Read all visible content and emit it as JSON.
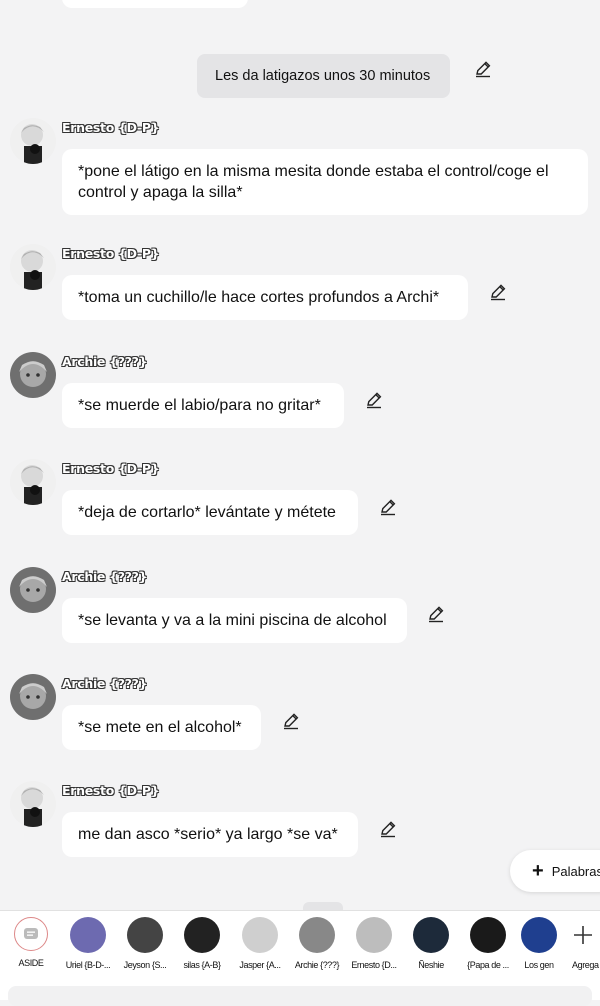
{
  "narration": "Les da latigazos unos 30 minutos",
  "messages": [
    {
      "name": "Ernesto {D-P}",
      "text": "*pone el látigo en la misma mesita donde estaba el control/coge el control y apaga la silla*"
    },
    {
      "name": "Ernesto {D-P}",
      "text": "*toma un cuchillo/le hace cortes profundos a Archi*"
    },
    {
      "name": "Archie {???}",
      "text": "*se muerde el labio/para no gritar*"
    },
    {
      "name": "Ernesto {D-P}",
      "text": "*deja de cortarlo* levántate y métete"
    },
    {
      "name": "Archie {???}",
      "text": "*se levanta y va a la mini piscina de alcohol"
    },
    {
      "name": "Archie {???}",
      "text": "*se mete en el alcohol*"
    },
    {
      "name": "Ernesto {D-P}",
      "text": "me dan asco *serio* ya largo *se va*"
    }
  ],
  "palabras_label": "Palabras",
  "characters": [
    {
      "label": "ASIDE",
      "icon": "aside-chat-icon"
    },
    {
      "label": "Uriel {B-D-...",
      "color": "#6d6ab0"
    },
    {
      "label": "Jeyson {S...",
      "color": "#444444"
    },
    {
      "label": "silas {A-B}",
      "color": "#222222"
    },
    {
      "label": "Jasper {A...",
      "color": "#cfcfcf"
    },
    {
      "label": "Archie {???}",
      "color": "#888888"
    },
    {
      "label": "Ernesto {D...",
      "color": "#bdbdbd"
    },
    {
      "label": "Ñeshie",
      "color": "#1d2a3a"
    },
    {
      "label": "{Papa de ...",
      "color": "#1a1a1a"
    },
    {
      "label": "Los gen",
      "color": "#1f3f8f"
    },
    {
      "label": "Agrega",
      "icon": "plus-icon"
    }
  ]
}
